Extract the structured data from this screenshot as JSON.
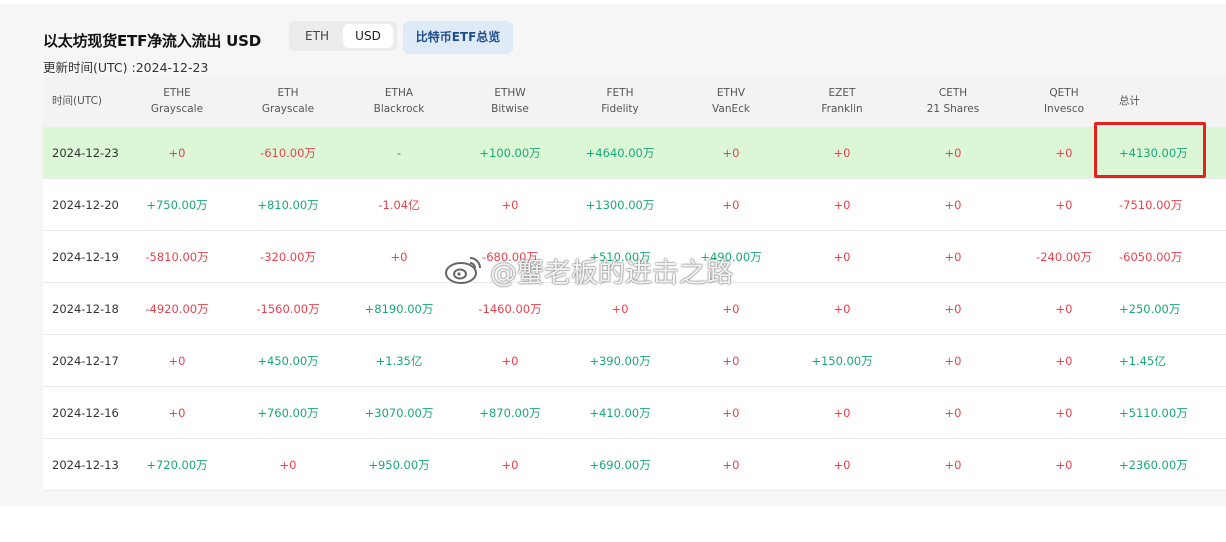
{
  "header": {
    "title": "以太坊现货ETF净流入流出 USD",
    "toggle": {
      "eth_label": "ETH",
      "usd_label": "USD",
      "selected": "USD"
    },
    "btc_overview_label": "比特币ETF总览",
    "updated_label": "更新时间(UTC) :2024-12-23"
  },
  "columns": [
    {
      "ticker": "时间(UTC)",
      "issuer": ""
    },
    {
      "ticker": "ETHE",
      "issuer": "Grayscale"
    },
    {
      "ticker": "ETH",
      "issuer": "Grayscale"
    },
    {
      "ticker": "ETHA",
      "issuer": "Blackrock"
    },
    {
      "ticker": "ETHW",
      "issuer": "Bitwise"
    },
    {
      "ticker": "FETH",
      "issuer": "Fidelity"
    },
    {
      "ticker": "ETHV",
      "issuer": "VanEck"
    },
    {
      "ticker": "EZET",
      "issuer": "Franklin"
    },
    {
      "ticker": "CETH",
      "issuer": "21 Shares"
    },
    {
      "ticker": "QETH",
      "issuer": "Invesco"
    },
    {
      "ticker": "总计",
      "issuer": ""
    }
  ],
  "rows": [
    {
      "date": "2024-12-23",
      "values": [
        "+0",
        "-610.00万",
        "-",
        "+100.00万",
        "+4640.00万",
        "+0",
        "+0",
        "+0",
        "+0"
      ],
      "total": "+4130.00万",
      "highlighted": true
    },
    {
      "date": "2024-12-20",
      "values": [
        "+750.00万",
        "+810.00万",
        "-1.04亿",
        "+0",
        "+1300.00万",
        "+0",
        "+0",
        "+0",
        "+0"
      ],
      "total": "-7510.00万"
    },
    {
      "date": "2024-12-19",
      "values": [
        "-5810.00万",
        "-320.00万",
        "+0",
        "-680.00万",
        "+510.00万",
        "+490.00万",
        "+0",
        "+0",
        "-240.00万"
      ],
      "total": "-6050.00万"
    },
    {
      "date": "2024-12-18",
      "values": [
        "-4920.00万",
        "-1560.00万",
        "+8190.00万",
        "-1460.00万",
        "+0",
        "+0",
        "+0",
        "+0",
        "+0"
      ],
      "total": "+250.00万"
    },
    {
      "date": "2024-12-17",
      "values": [
        "+0",
        "+450.00万",
        "+1.35亿",
        "+0",
        "+390.00万",
        "+0",
        "+150.00万",
        "+0",
        "+0"
      ],
      "total": "+1.45亿"
    },
    {
      "date": "2024-12-16",
      "values": [
        "+0",
        "+760.00万",
        "+3070.00万",
        "+870.00万",
        "+410.00万",
        "+0",
        "+0",
        "+0",
        "+0"
      ],
      "total": "+5110.00万"
    },
    {
      "date": "2024-12-13",
      "values": [
        "+720.00万",
        "+0",
        "+950.00万",
        "+0",
        "+690.00万",
        "+0",
        "+0",
        "+0",
        "+0"
      ],
      "total": "+2360.00万"
    }
  ],
  "colors": {
    "positive": "#19a87a",
    "negative": "#e8434f",
    "highlight_row": "#dcf7d6",
    "annotation_box": "#e8201a"
  },
  "watermark": {
    "text": "@蟹老板的进击之路",
    "icon": "weibo-icon"
  }
}
